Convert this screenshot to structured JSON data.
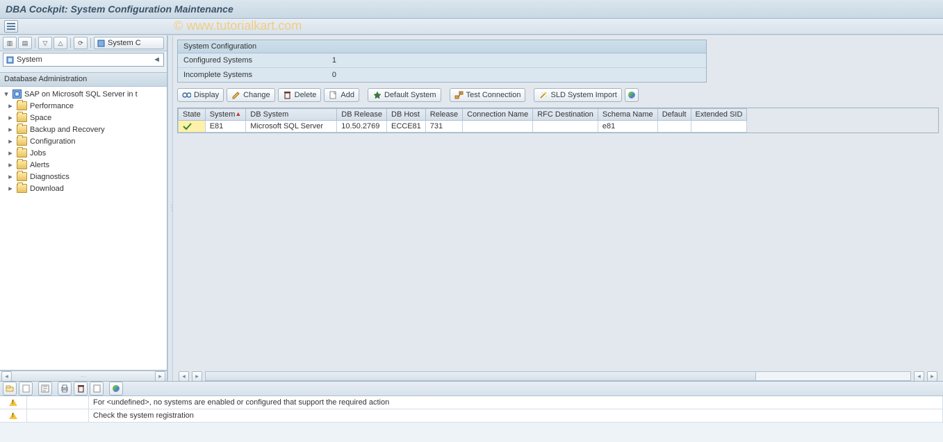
{
  "title": "DBA Cockpit: System Configuration Maintenance",
  "watermark": "© www.tutorialkart.com",
  "tree_toolbar": {
    "system_c_button": "System C"
  },
  "system_select": {
    "label": "System"
  },
  "tree_header": "Database Administration",
  "tree": {
    "root": "SAP on Microsoft SQL Server in t",
    "items": [
      "Performance",
      "Space",
      "Backup and Recovery",
      "Configuration",
      "Jobs",
      "Alerts",
      "Diagnostics",
      "Download"
    ]
  },
  "config_box": {
    "title": "System Configuration",
    "rows": [
      {
        "label": "Configured Systems",
        "value": "1"
      },
      {
        "label": "Incomplete Systems",
        "value": "0"
      }
    ]
  },
  "actions": {
    "display": "Display",
    "change": "Change",
    "delete": "Delete",
    "add": "Add",
    "default_system": "Default System",
    "test_connection": "Test Connection",
    "sld_import": "SLD System Import"
  },
  "grid": {
    "columns": [
      "State",
      "System",
      "DB System",
      "DB Release",
      "DB Host",
      "Release",
      "Connection Name",
      "RFC Destination",
      "Schema Name",
      "Default",
      "Extended SID"
    ],
    "sort_col_index": 1,
    "rows": [
      {
        "state": "ok",
        "system": "E81",
        "db_system": "Microsoft SQL Server",
        "db_release": "10.50.2769",
        "db_host": "ECCE81",
        "release": "731",
        "connection_name": "",
        "rfc_destination": "",
        "schema_name": "e81",
        "default": "",
        "extended_sid": ""
      }
    ]
  },
  "messages": [
    "For <undefined>, no systems are enabled or configured that support the required action",
    "Check the system registration"
  ]
}
